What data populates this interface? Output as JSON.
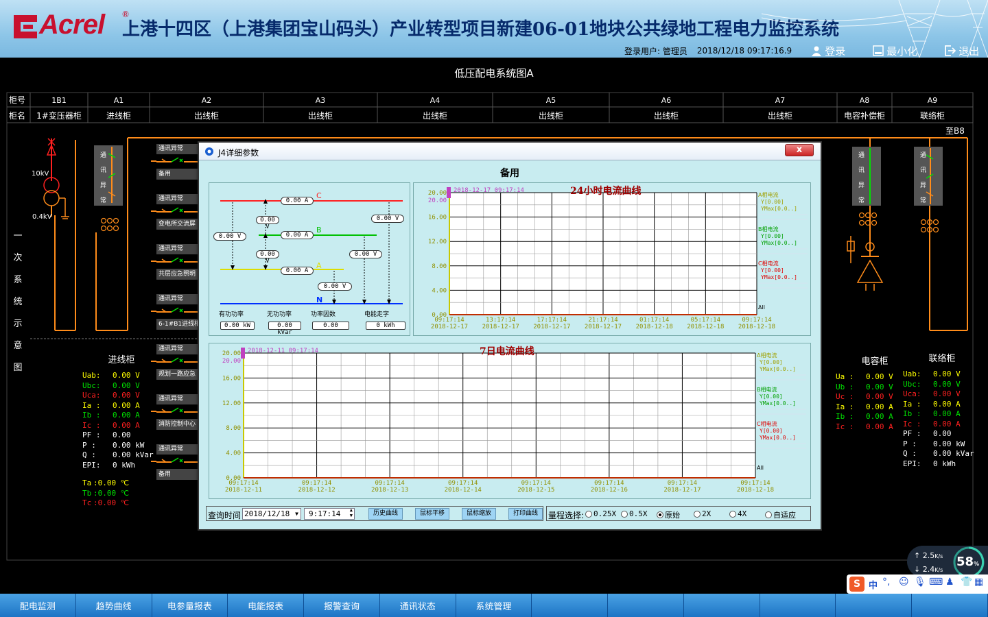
{
  "header": {
    "logo_text": "Acrel",
    "logo_reg": "®",
    "title": "上港十四区（上港集团宝山码头）产业转型项目新建06-01地块公共绿地工程电力监控系统",
    "login_user_label": "登录用户: 管理员",
    "datetime": "2018/12/18  09:17:16.9",
    "login_btn": "登录",
    "minimize_btn": "最小化",
    "exit_btn": "退出"
  },
  "diagram": {
    "title": "低压配电系统图A",
    "row_label_no": "柜号",
    "row_label_name": "柜名",
    "cabinets": [
      {
        "no": "1B1",
        "name": "1#变压器柜"
      },
      {
        "no": "A1",
        "name": "进线柜"
      },
      {
        "no": "A2",
        "name": "出线柜"
      },
      {
        "no": "A3",
        "name": "出线柜"
      },
      {
        "no": "A4",
        "name": "出线柜"
      },
      {
        "no": "A5",
        "name": "出线柜"
      },
      {
        "no": "A6",
        "name": "出线柜"
      },
      {
        "no": "A7",
        "name": "出线柜"
      },
      {
        "no": "A8",
        "name": "电容补偿柜"
      },
      {
        "no": "A9",
        "name": "联络柜"
      }
    ],
    "to_b8": "至B8",
    "hv_label": "10kV",
    "lv_label": "0.4kV",
    "comm_vertical": [
      "通",
      "讯",
      "异",
      "常"
    ],
    "side_vertical": [
      "一",
      "次",
      "系",
      "统",
      "示",
      "意",
      "图"
    ],
    "branches": [
      {
        "alarm": "通讯异常",
        "name": "备用"
      },
      {
        "alarm": "通讯异常",
        "name": "变电所交流屏"
      },
      {
        "alarm": "通讯异常",
        "name": "共层应急照明"
      },
      {
        "alarm": "通讯异常",
        "name": "6-1#B1进线柜"
      },
      {
        "alarm": "通讯异常",
        "name": "规划一路应急"
      },
      {
        "alarm": "通讯异常",
        "name": "消防控制中心"
      },
      {
        "alarm": "通讯异常",
        "name": "备用"
      }
    ]
  },
  "meters": {
    "incoming": {
      "title": "进线柜",
      "rows": [
        {
          "k": "Uab:",
          "v": "0.00  V",
          "c": "yellow"
        },
        {
          "k": "Ubc:",
          "v": "0.00  V",
          "c": "green"
        },
        {
          "k": "Uca:",
          "v": "0.00  V",
          "c": "red"
        },
        {
          "k": "Ia  :",
          "v": "0.00  A",
          "c": "yellow"
        },
        {
          "k": "Ib  :",
          "v": "0.00  A",
          "c": "green"
        },
        {
          "k": "Ic  :",
          "v": "0.00  A",
          "c": "red"
        },
        {
          "k": "PF  :",
          "v": "0.00",
          "c": "white"
        },
        {
          "k": "P   :",
          "v": "0.00 kW",
          "c": "white"
        },
        {
          "k": "Q   :",
          "v": "0.00 kVar",
          "c": "white"
        },
        {
          "k": "EPI:",
          "v": "  0 kWh",
          "c": "white"
        }
      ],
      "temps": [
        {
          "k": "Ta",
          "v": ":0.00 ℃",
          "c": "yellow"
        },
        {
          "k": "Tb",
          "v": ":0.00 ℃",
          "c": "green"
        },
        {
          "k": "Tc",
          "v": ":0.00 ℃",
          "c": "red"
        }
      ]
    },
    "capacitor": {
      "title": "电容柜",
      "rows": [
        {
          "k": "Ua :",
          "v": "0.00 V",
          "c": "yellow"
        },
        {
          "k": "Ub :",
          "v": "0.00 V",
          "c": "green"
        },
        {
          "k": "Uc :",
          "v": "0.00 V",
          "c": "red"
        },
        {
          "k": "Ia :",
          "v": "0.00 A",
          "c": "yellow"
        },
        {
          "k": "Ib :",
          "v": "0.00 A",
          "c": "green"
        },
        {
          "k": "Ic :",
          "v": "0.00 A",
          "c": "red"
        }
      ]
    },
    "tie": {
      "title": "联络柜",
      "rows": [
        {
          "k": "Uab:",
          "v": "0.00 V",
          "c": "yellow"
        },
        {
          "k": "Ubc:",
          "v": "0.00 V",
          "c": "green"
        },
        {
          "k": "Uca:",
          "v": "0.00 V",
          "c": "red"
        },
        {
          "k": "Ia :",
          "v": "0.00 A",
          "c": "yellow"
        },
        {
          "k": "Ib :",
          "v": "0.00 A",
          "c": "green"
        },
        {
          "k": "Ic :",
          "v": "0.00 A",
          "c": "red"
        },
        {
          "k": "PF :",
          "v": "0.00",
          "c": "white"
        },
        {
          "k": "P  :",
          "v": "0.00 kW",
          "c": "white"
        },
        {
          "k": "Q  :",
          "v": "0.00 kVar",
          "c": "white"
        },
        {
          "k": "EPI:",
          "v": " 0 kWh",
          "c": "white"
        }
      ]
    }
  },
  "dialog": {
    "title": "J4详细参数",
    "close": "x",
    "heading": "备用",
    "phase": {
      "label_c": "C",
      "label_b": "B",
      "label_a": "A",
      "label_n": "N",
      "val_c": "0.00 A",
      "val_b": "0.00 A",
      "val_a": "0.00 A",
      "v_ca": "0.00 V",
      "v_bc": "0.00 V",
      "v_ab": "0.00 V",
      "v_cn": "0.00 V",
      "v_bn": "0.00 V",
      "v_an": "0.00 V",
      "v_left": "0.00 V",
      "stat_labels": [
        "有功功率",
        "无功功率",
        "功率因数",
        "电能走字"
      ],
      "stat_values": [
        "0.00 kW",
        "0.00 kVar",
        "0.00",
        "0 kWh"
      ]
    },
    "query": {
      "label": "查询时间",
      "date": "2018/12/18",
      "time": "9:17:14",
      "buttons": [
        "历史曲线",
        "鼠标平移",
        "鼠标缩放",
        "打印曲线"
      ]
    },
    "range": {
      "label": "量程选择:",
      "options": [
        "0.25X",
        "0.5X",
        "原始",
        "2X",
        "4X",
        "自适应"
      ],
      "selected": "原始"
    }
  },
  "chart_data": [
    {
      "type": "line",
      "title": "24小时电流曲线",
      "marker_time": "2018-12-17  09:17:14",
      "ylim": [
        0,
        20
      ],
      "yticks": [
        "0.00",
        "4.00",
        "8.00",
        "12.00",
        "16.00",
        "20.00"
      ],
      "ytop_label": "20.00",
      "xticks": [
        [
          "09:17:14",
          "2018-12-17"
        ],
        [
          "13:17:14",
          "2018-12-17"
        ],
        [
          "17:17:14",
          "2018-12-17"
        ],
        [
          "21:17:14",
          "2018-12-17"
        ],
        [
          "01:17:14",
          "2018-12-18"
        ],
        [
          "05:17:14",
          "2018-12-18"
        ],
        [
          "09:17:14",
          "2018-12-18"
        ]
      ],
      "legend": [
        {
          "name": "A相电流",
          "y": "Y[0.00]",
          "ymax": "YMax[0.0..]",
          "color": "#c8c800"
        },
        {
          "name": "B相电流",
          "y": "Y[0.00]",
          "ymax": "YMax[0.0..]",
          "color": "#00a000"
        },
        {
          "name": "C相电流",
          "y": "Y[0.00]",
          "ymax": "YMax[0.0..]",
          "color": "#e00000"
        }
      ],
      "legend_all": "All",
      "series": [
        {
          "name": "A相电流",
          "values": [
            0,
            0,
            0,
            0,
            0,
            0,
            0
          ]
        },
        {
          "name": "B相电流",
          "values": [
            0,
            0,
            0,
            0,
            0,
            0,
            0
          ]
        },
        {
          "name": "C相电流",
          "values": [
            0,
            0,
            0,
            0,
            0,
            0,
            0
          ]
        }
      ],
      "grid": true
    },
    {
      "type": "line",
      "title": "7日电流曲线",
      "marker_time": "2018-12-11  09:17:14",
      "ylim": [
        0,
        20
      ],
      "yticks": [
        "0.00",
        "4.00",
        "8.00",
        "12.00",
        "16.00",
        "20.00"
      ],
      "ytop_label": "20.00",
      "xticks": [
        [
          "09:17:14",
          "2018-12-11"
        ],
        [
          "09:17:14",
          "2018-12-12"
        ],
        [
          "09:17:14",
          "2018-12-13"
        ],
        [
          "09:17:14",
          "2018-12-14"
        ],
        [
          "09:17:14",
          "2018-12-15"
        ],
        [
          "09:17:14",
          "2018-12-16"
        ],
        [
          "09:17:14",
          "2018-12-17"
        ],
        [
          "09:17:14",
          "2018-12-18"
        ]
      ],
      "legend": [
        {
          "name": "A相电流",
          "y": "Y[0.00]",
          "ymax": "YMax[0.0..]",
          "color": "#c8c800"
        },
        {
          "name": "B相电流",
          "y": "Y[0.00]",
          "ymax": "YMax[0.0..]",
          "color": "#00a000"
        },
        {
          "name": "C相电流",
          "y": "Y[0.00]",
          "ymax": "YMax[0.0..]",
          "color": "#e00000"
        }
      ],
      "legend_all": "All",
      "series": [
        {
          "name": "A相电流",
          "values": [
            0,
            0,
            0,
            0,
            0,
            0,
            0,
            0
          ]
        },
        {
          "name": "B相电流",
          "values": [
            0,
            0,
            0,
            0,
            0,
            0,
            0,
            0
          ]
        },
        {
          "name": "C相电流",
          "values": [
            0,
            0,
            0,
            0,
            0,
            0,
            0,
            0
          ]
        }
      ],
      "grid": true
    }
  ],
  "widgets": {
    "upload_speed": "2.5",
    "download_speed": "2.4",
    "speed_unit": "K/s",
    "cpu_percent": "58",
    "percent_sign": "%",
    "ime_label": "中"
  },
  "navbar": [
    "配电监测",
    "趋势曲线",
    "电参量报表",
    "电能报表",
    "报警查询",
    "通讯状态",
    "系统管理",
    "",
    "",
    "",
    "",
    "",
    ""
  ],
  "colors": {
    "busbar": "#ff8c1a",
    "phase_a": "#ffff00",
    "phase_b": "#00e000",
    "phase_c": "#ff2020",
    "phase_n": "#0030ff",
    "chart_axis": "#c8c800",
    "marker": "#c040c0"
  }
}
